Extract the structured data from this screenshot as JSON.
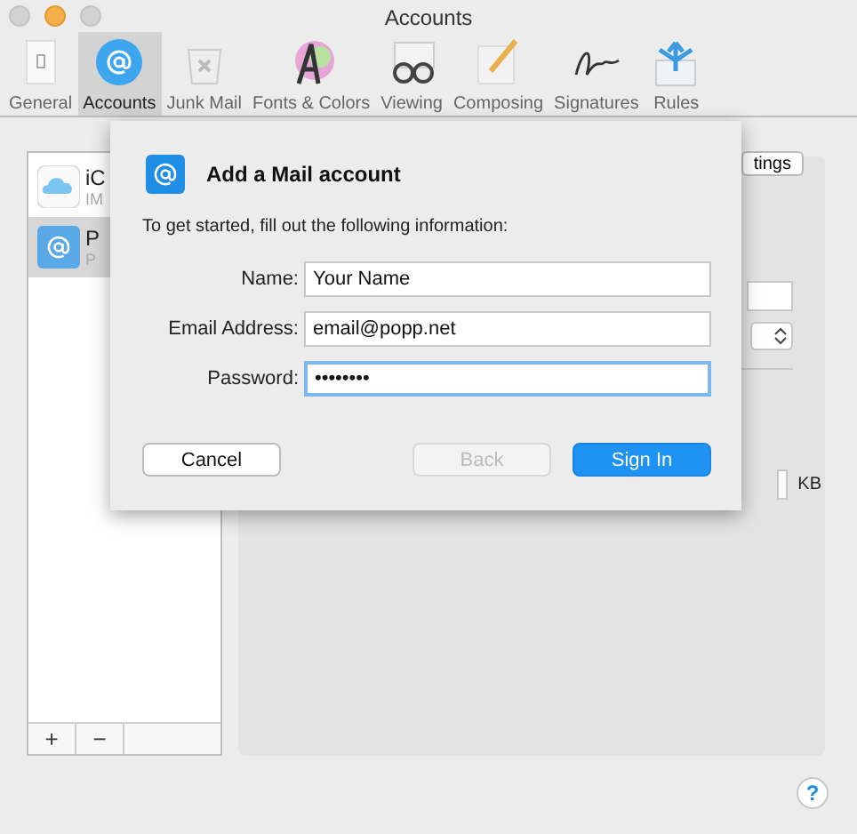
{
  "window": {
    "title": "Accounts"
  },
  "toolbar": [
    {
      "label": "General",
      "selected": false
    },
    {
      "label": "Accounts",
      "selected": true
    },
    {
      "label": "Junk Mail",
      "selected": false
    },
    {
      "label": "Fonts & Colors",
      "selected": false
    },
    {
      "label": "Viewing",
      "selected": false
    },
    {
      "label": "Composing",
      "selected": false
    },
    {
      "label": "Signatures",
      "selected": false
    },
    {
      "label": "Rules",
      "selected": false
    }
  ],
  "accounts": [
    {
      "kind": "cloud",
      "name": "iC",
      "detail": "IM",
      "selected": false
    },
    {
      "kind": "mail",
      "name": "P",
      "detail": "P",
      "selected": true
    }
  ],
  "list_buttons": [
    "+",
    "−"
  ],
  "details": {
    "settings_button": "tings",
    "unit": "KB"
  },
  "sheet": {
    "title": "Add a Mail account",
    "intro": "To get started, fill out the following information:",
    "fields": [
      {
        "label": "Name:",
        "value": "Your Name",
        "focused": false
      },
      {
        "label": "Email Address:",
        "value": "email@popp.net",
        "focused": false
      },
      {
        "label": "Password:",
        "value": "••••••••",
        "focused": true
      }
    ],
    "buttons": [
      {
        "label": "Cancel",
        "kind": "normal",
        "disabled": false
      },
      {
        "label": "Back",
        "kind": "normal",
        "disabled": true
      },
      {
        "label": "Sign In",
        "kind": "default",
        "disabled": false
      }
    ]
  },
  "help": "?"
}
